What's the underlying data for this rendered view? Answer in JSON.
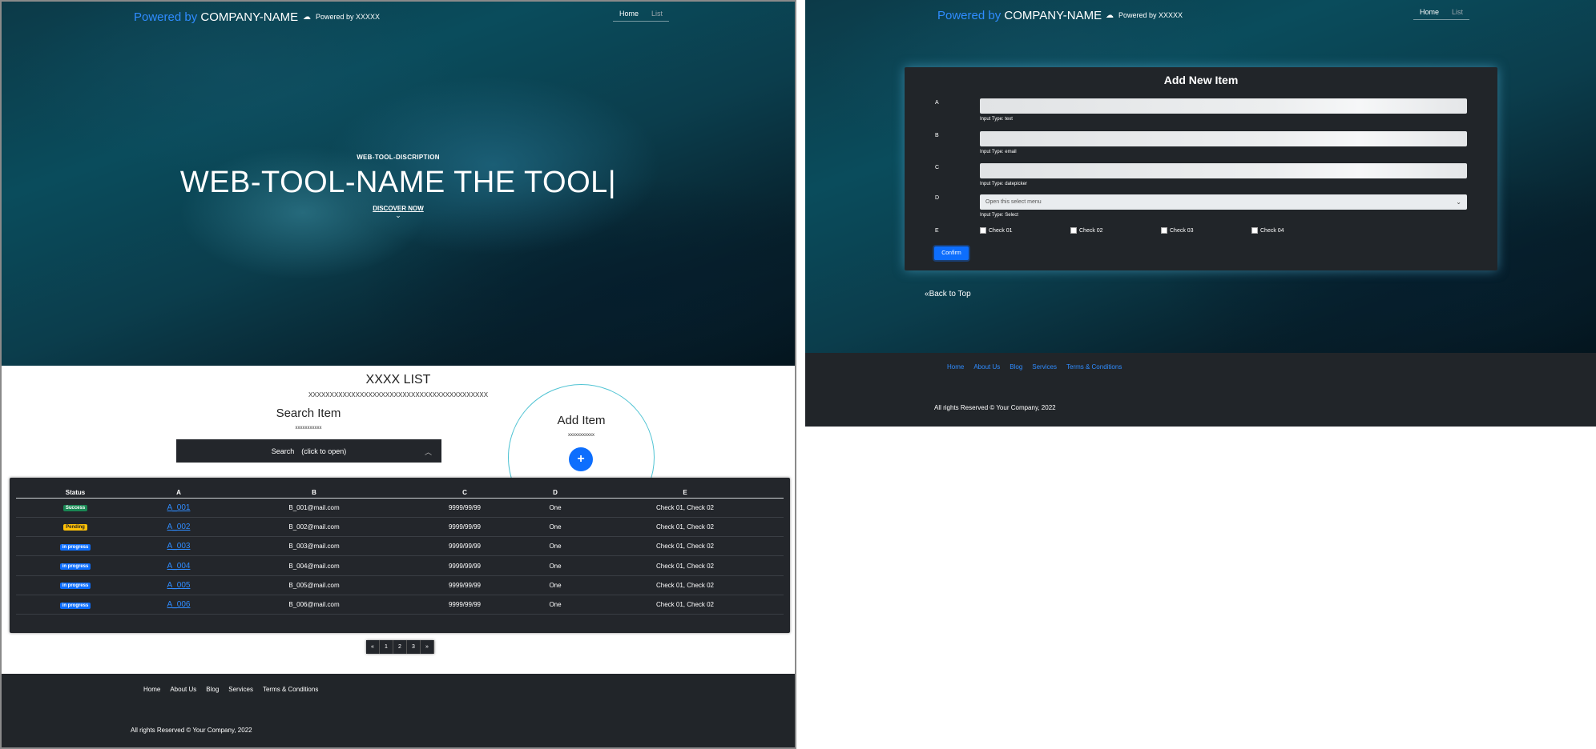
{
  "nav": {
    "brand_powered": "Powered by",
    "brand_company": "COMPANY-NAME",
    "powered_small": "Powered by XXXXX",
    "links": [
      "Home",
      "List"
    ]
  },
  "hero": {
    "subtitle": "WEB-TOOL-DISCRIPTION",
    "title": "WEB-TOOL-NAME THE TOOL|",
    "discover": "DISCOVER NOW"
  },
  "list": {
    "title": "XXXX LIST",
    "subtitle": "XXXXXXXXXXXXXXXXXXXXXXXXXXXXXXXXXXXXXXXXXX"
  },
  "search": {
    "title": "Search Item",
    "subtitle": "xxxxxxxxxxx",
    "box_label": "Search　(click to open)"
  },
  "add": {
    "title": "Add Item",
    "subtitle": "xxxxxxxxxxx",
    "button": "+"
  },
  "table": {
    "headers": [
      "Status",
      "A",
      "B",
      "C",
      "D",
      "E"
    ],
    "rows": [
      {
        "status": "Success",
        "status_type": "success",
        "a": "A_001",
        "b": "B_001@mail.com",
        "c": "9999/99/99",
        "d": "One",
        "e": "Check 01, Check 02"
      },
      {
        "status": "Pending",
        "status_type": "pending",
        "a": "A_002",
        "b": "B_002@mail.com",
        "c": "9999/99/99",
        "d": "One",
        "e": "Check 01, Check 02"
      },
      {
        "status": "in progress",
        "status_type": "progress",
        "a": "A_003",
        "b": "B_003@mail.com",
        "c": "9999/99/99",
        "d": "One",
        "e": "Check 01, Check 02"
      },
      {
        "status": "in progress",
        "status_type": "progress",
        "a": "A_004",
        "b": "B_004@mail.com",
        "c": "9999/99/99",
        "d": "One",
        "e": "Check 01, Check 02"
      },
      {
        "status": "in progress",
        "status_type": "progress",
        "a": "A_005",
        "b": "B_005@mail.com",
        "c": "9999/99/99",
        "d": "One",
        "e": "Check 01, Check 02"
      },
      {
        "status": "in progress",
        "status_type": "progress",
        "a": "A_006",
        "b": "B_006@mail.com",
        "c": "9999/99/99",
        "d": "One",
        "e": "Check 01, Check 02"
      }
    ]
  },
  "pagination": [
    "«",
    "1",
    "2",
    "3",
    "»"
  ],
  "footer": {
    "links": [
      "Home",
      "About Us",
      "Blog",
      "Services",
      "Terms & Conditions"
    ],
    "copyright": "All rights Reserved © Your Company, 2022"
  },
  "form": {
    "title": "Add New Item",
    "fields": [
      {
        "label": "A",
        "help": "Input Type: text"
      },
      {
        "label": "B",
        "help": "Input Type: email"
      },
      {
        "label": "C",
        "help": "Input Type: datepicker"
      },
      {
        "label": "D",
        "help": "Input Type: Select",
        "placeholder": "Open this select menu"
      },
      {
        "label": "E"
      }
    ],
    "checks": [
      "Check 01",
      "Check 02",
      "Check 03",
      "Check 04"
    ],
    "confirm": "Confirm",
    "back_to_top": "Back to Top"
  },
  "colors": {
    "brand_blue": "#2f8cff",
    "dark": "#212529",
    "primary": "#0d6efd",
    "success": "#198754",
    "pending": "#ffc107"
  }
}
